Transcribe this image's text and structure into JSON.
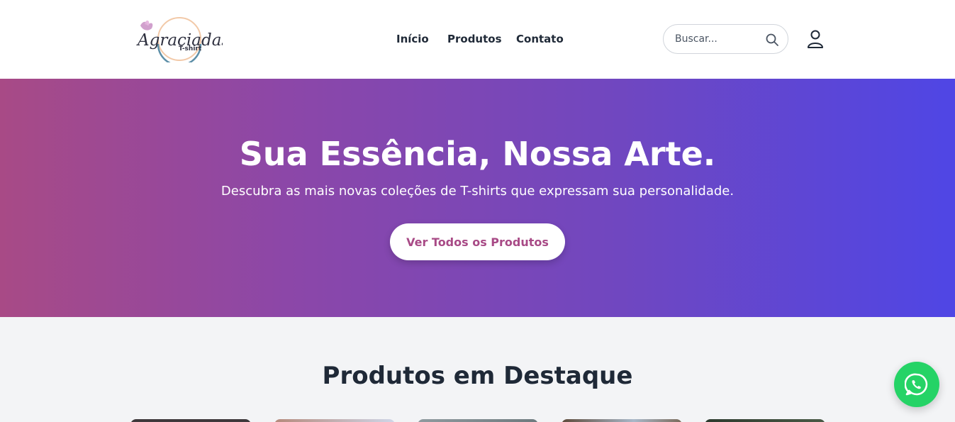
{
  "header": {
    "logo": {
      "text": "Agraciadas",
      "subtext": "T-shirt"
    },
    "nav": [
      {
        "label": "Início"
      },
      {
        "label": "Produtos"
      },
      {
        "label": "Contato"
      }
    ],
    "search": {
      "placeholder": "Buscar...",
      "value": "",
      "icon": "search-icon"
    },
    "user_icon": "user-icon"
  },
  "hero": {
    "title": "Sua Essência, Nossa Arte.",
    "subtitle": "Descubra as mais novas coleções de T-shirts que expressam sua personalidade.",
    "button_label": "Ver Todos os Produtos",
    "gradient": [
      "#a84a86",
      "#4f46e5"
    ]
  },
  "featured": {
    "title": "Produtos em Destaque",
    "products": [
      {
        "thumb_color": "#3a3538"
      },
      {
        "thumb_color": "#b58a7c"
      },
      {
        "thumb_color": "#8f9a9f"
      },
      {
        "thumb_color": "#5d4a3a"
      },
      {
        "thumb_color": "#2c3a2e"
      }
    ]
  },
  "whatsapp": {
    "icon": "whatsapp-icon",
    "color": "#25d366"
  }
}
